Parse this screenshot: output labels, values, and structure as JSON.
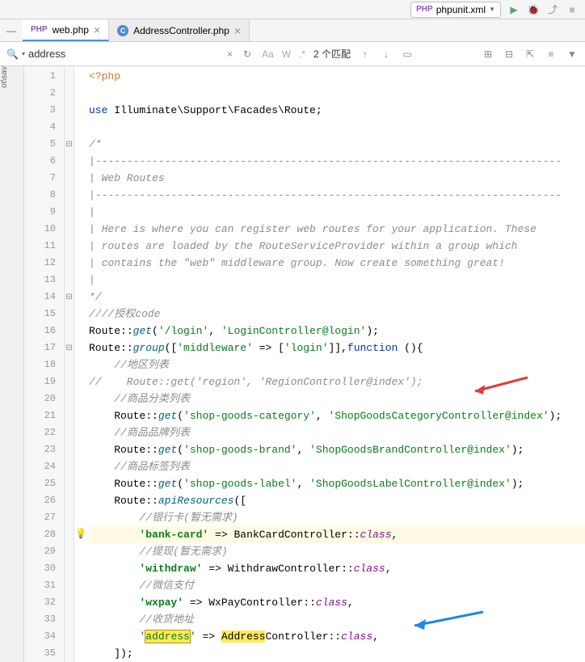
{
  "top": {
    "config": "phpunit.xml"
  },
  "tabs": {
    "active": "web.php",
    "inactive": "AddressController.php"
  },
  "sidelabel": "ot\\sav",
  "find": {
    "query": "address",
    "matches": "2 个匹配",
    "optAa": "Aa",
    "optW": "W",
    "optStar": ".*"
  },
  "lines": {
    "1": "1",
    "2": "2",
    "3": "3",
    "4": "4",
    "5": "5",
    "6": "6",
    "7": "7",
    "8": "8",
    "9": "9",
    "10": "10",
    "11": "11",
    "12": "12",
    "13": "13",
    "14": "14",
    "15": "15",
    "16": "16",
    "17": "17",
    "18": "18",
    "19": "19",
    "20": "20",
    "21": "21",
    "22": "22",
    "23": "23",
    "24": "24",
    "25": "25",
    "26": "26",
    "27": "27",
    "28": "28",
    "29": "29",
    "30": "30",
    "31": "31",
    "32": "32",
    "33": "33",
    "34": "34",
    "35": "35"
  },
  "code": {
    "php_open": "<?php",
    "use": "use",
    "use_ns": " Illuminate\\Support\\Facades\\Route;",
    "c_open": "/*",
    "c_dash1": "|--------------------------------------------------------------------------",
    "c_web": "| Web Routes",
    "c_dash2": "|--------------------------------------------------------------------------",
    "c_pipe": "|",
    "c_l1": "| Here is where you can register web routes for your application. These",
    "c_l2": "| routes are loaded by the RouteServiceProvider within a group which",
    "c_l3": "| contains the \"web\" middleware group. Now create something great!",
    "c_close": "*/",
    "c_auth": "////授权code",
    "route": "Route",
    "get": "get",
    "group": "group",
    "apiResources": "apiResources",
    "login_path": "'/login'",
    "login_ctrl": "'LoginController@login'",
    "mw_key": "'middleware'",
    "login_arr": "'login'",
    "function": "function",
    "c_region": "//地区列表",
    "c_region_get": "//    Route::get('region', 'RegionController@index');",
    "c_cat": "//商品分类列表",
    "cat_path": "'shop-goods-category'",
    "cat_ctrl": "'ShopGoodsCategoryController@index'",
    "c_brand": "//商品品牌列表",
    "brand_path": "'shop-goods-brand'",
    "brand_ctrl": "'ShopGoodsBrandController@index'",
    "c_label": "//商品标签列表",
    "label_path": "'shop-goods-label'",
    "label_ctrl": "'ShopGoodsLabelController@index'",
    "c_bank": "//银行卡(暂无需求)",
    "bank_key": "'bank-card'",
    "bank_ctrl": "BankCardController",
    "class": "class",
    "c_withdraw": "//提现(暂无需求)",
    "wd_key": "'withdraw'",
    "wd_ctrl": "WithdrawController",
    "c_wxpay": "//微信支付",
    "wx_key": "'wxpay'",
    "wx_ctrl": "WxPayController",
    "c_addr": "//收货地址",
    "addr_q1": "'",
    "addr_key": "address",
    "addr_q2": "'",
    "addr_ctrl_a": "Address",
    "addr_ctrl_b": "Controller",
    "close_arr": "]);"
  }
}
